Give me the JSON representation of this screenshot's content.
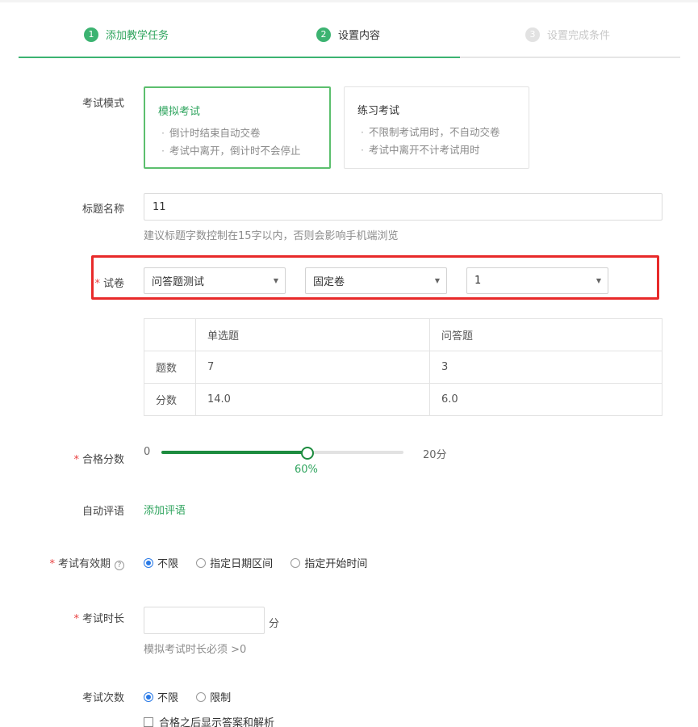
{
  "steps": [
    {
      "num": "1",
      "label": "添加教学任务"
    },
    {
      "num": "2",
      "label": "设置内容"
    },
    {
      "num": "3",
      "label": "设置完成条件"
    }
  ],
  "exam_mode": {
    "label": "考试模式",
    "options": [
      {
        "title": "模拟考试",
        "desc": [
          "倒计时结束自动交卷",
          "考试中离开，倒计时不会停止"
        ]
      },
      {
        "title": "练习考试",
        "desc": [
          "不限制考试用时，不自动交卷",
          "考试中离开不计考试用时"
        ]
      }
    ]
  },
  "title_field": {
    "label": "标题名称",
    "value": "11",
    "hint": "建议标题字数控制在15字以内，否则会影响手机端浏览"
  },
  "paper": {
    "required": "*",
    "label": "试卷",
    "selects": [
      "问答题测试",
      "固定卷",
      "1"
    ],
    "table": {
      "headers": [
        "",
        "单选题",
        "问答题"
      ],
      "rows": [
        [
          "题数",
          "7",
          "3"
        ],
        [
          "分数",
          "14.0",
          "6.0"
        ]
      ]
    }
  },
  "pass_score": {
    "required": "*",
    "label": "合格分数",
    "min": "0",
    "max": "20分",
    "percent_label": "60%",
    "value_fraction": 0.6
  },
  "auto_comment": {
    "label": "自动评语",
    "link": "添加评语"
  },
  "validity": {
    "required": "*",
    "label": "考试有效期",
    "help": "?",
    "options": [
      "不限",
      "指定日期区间",
      "指定开始时间"
    ],
    "selected": 0
  },
  "duration": {
    "required": "*",
    "label": "考试时长",
    "value": "",
    "unit": "分",
    "hint": "模拟考试时长必须 >0"
  },
  "attempts": {
    "label": "考试次数",
    "options": [
      "不限",
      "限制"
    ],
    "selected": 0,
    "checkbox_label": "合格之后显示答案和解析"
  },
  "colors": {
    "accent": "#3cb371",
    "highlight_box": "#e82a2a",
    "radio": "#2979e6",
    "required": "#e94040"
  }
}
